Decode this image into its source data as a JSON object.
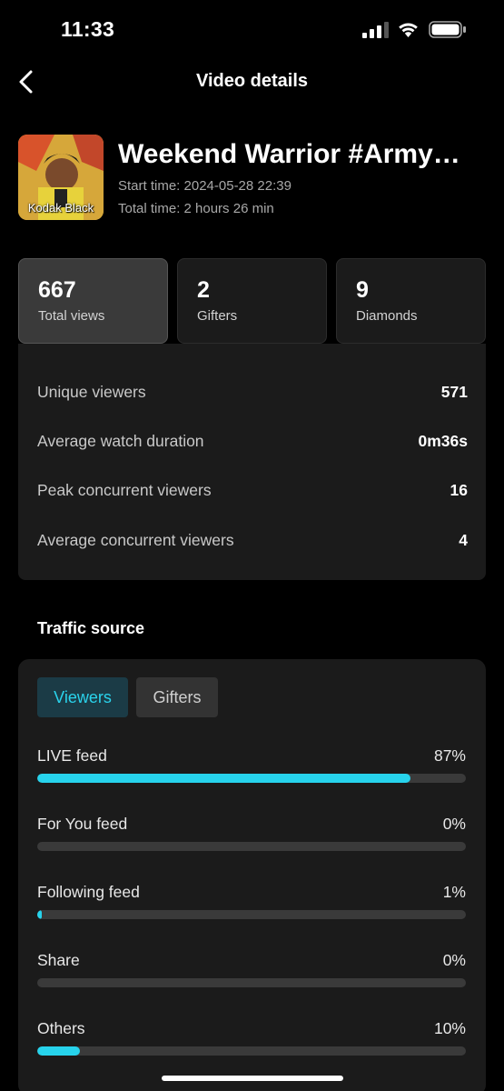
{
  "status_bar": {
    "time": "11:33"
  },
  "nav": {
    "title": "Video details"
  },
  "stream": {
    "thumbnail_caption": "Kodak Black",
    "title": "Weekend Warrior #Army…",
    "start_time": "Start time: 2024-05-28 22:39",
    "total_time": "Total time: 2 hours 26 min"
  },
  "stat_cards": [
    {
      "value": "667",
      "label": "Total views"
    },
    {
      "value": "2",
      "label": "Gifters"
    },
    {
      "value": "9",
      "label": "Diamonds"
    }
  ],
  "metrics": [
    {
      "label": "Unique viewers",
      "value": "571"
    },
    {
      "label": "Average watch duration",
      "value": "0m36s"
    },
    {
      "label": "Peak concurrent viewers",
      "value": "16"
    },
    {
      "label": "Average concurrent viewers",
      "value": "4"
    }
  ],
  "traffic": {
    "section_title": "Traffic source",
    "tabs": [
      {
        "label": "Viewers"
      },
      {
        "label": "Gifters"
      }
    ],
    "sources": [
      {
        "name": "LIVE feed",
        "percent_text": "87%",
        "fraction": 0.87
      },
      {
        "name": "For You feed",
        "percent_text": "0%",
        "fraction": 0.0
      },
      {
        "name": "Following feed",
        "percent_text": "1%",
        "fraction": 0.01
      },
      {
        "name": "Share",
        "percent_text": "0%",
        "fraction": 0.0
      },
      {
        "name": "Others",
        "percent_text": "10%",
        "fraction": 0.1
      }
    ],
    "accent_color": "#27d3ec"
  },
  "icons": [
    "cellular-signal-icon",
    "wifi-icon",
    "battery-icon",
    "back-arrow-icon"
  ]
}
